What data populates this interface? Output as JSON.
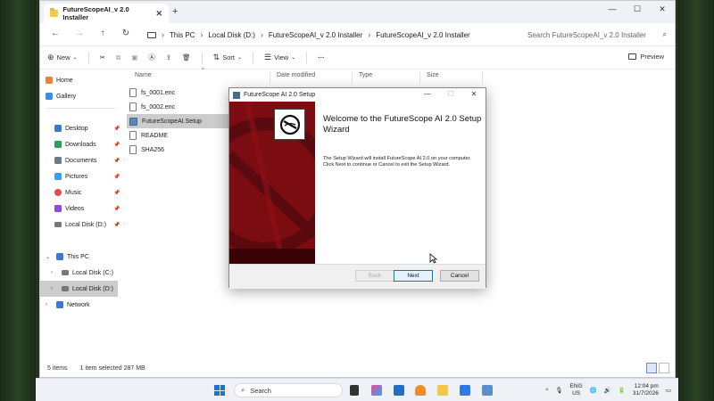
{
  "window": {
    "tab_title": "FutureScopeAI_v 2.0 Installer",
    "tab_close": "✕",
    "new_tab": "+",
    "controls": {
      "minimize": "—",
      "maximize": "☐",
      "close": "✕"
    }
  },
  "address": {
    "back": "←",
    "forward": "→",
    "up": "↑",
    "refresh": "↻",
    "breadcrumbs": [
      "This PC",
      "Local Disk (D:)",
      "FutureScopeAI_v 2.0 Installer",
      "FutureScopeAI_v 2.0 Installer"
    ],
    "separator": "›",
    "search_placeholder": "Search FutureScopeAI_v 2.0 Installer"
  },
  "toolbar": {
    "new_label": "New",
    "sort_label": "Sort",
    "view_label": "View",
    "more_label": "···",
    "preview_label": "Preview"
  },
  "sidebar": {
    "items": [
      {
        "label": "Home",
        "icon": "home-icon",
        "color": "#e8833a"
      },
      {
        "label": "Gallery",
        "icon": "gallery-icon",
        "color": "#3a8ee8"
      },
      {
        "label": "Desktop",
        "icon": "desktop-icon",
        "color": "#3a78d8"
      },
      {
        "label": "Downloads",
        "icon": "download-icon",
        "color": "#2e9e5b"
      },
      {
        "label": "Documents",
        "icon": "documents-icon",
        "color": "#6b7a8c"
      },
      {
        "label": "Pictures",
        "icon": "pictures-icon",
        "color": "#3aa0e8"
      },
      {
        "label": "Music",
        "icon": "music-icon",
        "color": "#e84a4a"
      },
      {
        "label": "Videos",
        "icon": "videos-icon",
        "color": "#8a4ae8"
      },
      {
        "label": "Local Disk (D:)",
        "icon": "drive-icon",
        "color": "#777777"
      },
      {
        "label": "This PC",
        "icon": "pc-icon",
        "color": "#3a78d8"
      },
      {
        "label": "Local Disk (C:)",
        "icon": "drive-icon",
        "color": "#777777"
      },
      {
        "label": "Local Disk (D:)",
        "icon": "drive-icon",
        "color": "#777777"
      },
      {
        "label": "Network",
        "icon": "network-icon",
        "color": "#3a78d8"
      }
    ]
  },
  "files": {
    "columns": [
      "Name",
      "Date modified",
      "Type",
      "Size"
    ],
    "rows": [
      "fs_0001.enc",
      "fs_0002.enc",
      "FutureScopeAI.Setup",
      "README",
      "SHA256"
    ]
  },
  "status": {
    "count": "5 items",
    "selection": "1 item selected  287 MB"
  },
  "wizard": {
    "title": "FutureScope AI 2.0 Setup",
    "heading": "Welcome to the FutureScope AI 2.0 Setup Wizard",
    "body": "The Setup Wizard will install FutureScope AI 2.0 on your computer. Click Next to continue or Cancel to exit the Setup Wizard.",
    "back_label": "Back",
    "next_label": "Next",
    "cancel_label": "Cancel",
    "banner_color": "#7a0c12"
  },
  "taskbar": {
    "search_label": "Search",
    "lang_top": "ENG",
    "lang_bottom": "US",
    "time": "12:04 pm",
    "date": "31/7/2026"
  }
}
